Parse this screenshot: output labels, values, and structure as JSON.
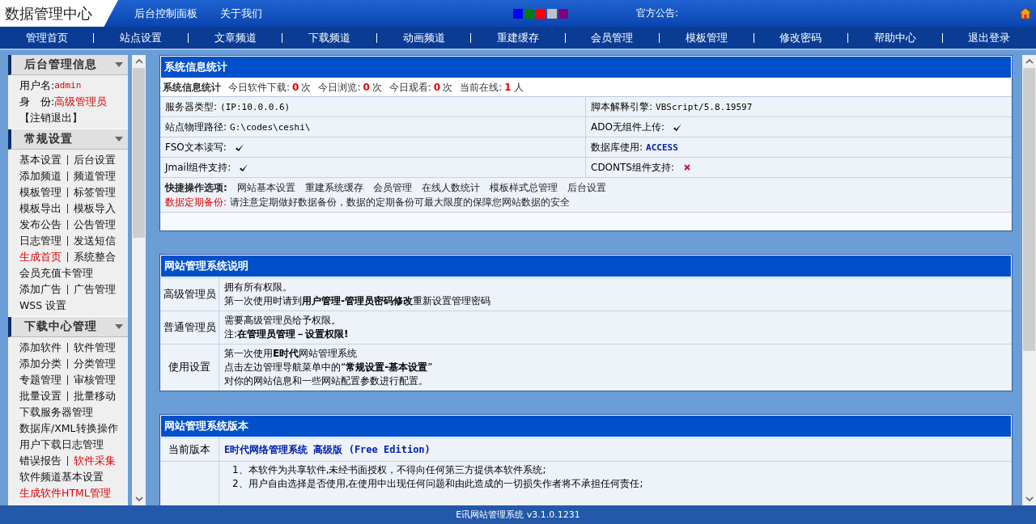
{
  "header": {
    "logo": "数据管理中心",
    "links": [
      "后台控制面板",
      "关于我们"
    ],
    "themes": [
      {
        "color": "#0000ff",
        "selected": false
      },
      {
        "color": "#008000",
        "selected": false
      },
      {
        "color": "#ff0000",
        "selected": false
      },
      {
        "color": "#c0c0c0",
        "selected": false
      },
      {
        "color": "#800080",
        "selected": false
      }
    ],
    "notice_label": "官方公告:"
  },
  "nav": [
    "管理首页",
    "站点设置",
    "文章频道",
    "下载频道",
    "动画频道",
    "重建缓存",
    "会员管理",
    "模板管理",
    "修改密码",
    "帮助中心",
    "退出登录"
  ],
  "sidebar": {
    "groups": [
      {
        "title": "后台管理信息",
        "expanded": true,
        "kind": "user",
        "username_label": "用户名:",
        "username": "admin",
        "role_label": "身　份:",
        "role": "高级管理员",
        "logout": "【注销退出】"
      },
      {
        "title": "常规设置",
        "expanded": true,
        "kind": "links",
        "lines": [
          [
            {
              "label": "基本设置",
              "emphasis": false
            },
            {
              "label": "后台设置",
              "emphasis": false
            }
          ],
          [
            {
              "label": "添加频道",
              "emphasis": false
            },
            {
              "label": "频道管理",
              "emphasis": false
            }
          ],
          [
            {
              "label": "模板管理",
              "emphasis": false
            },
            {
              "label": "标签管理",
              "emphasis": false
            }
          ],
          [
            {
              "label": "模板导出",
              "emphasis": false
            },
            {
              "label": "模板导入",
              "emphasis": false
            }
          ],
          [
            {
              "label": "发布公告",
              "emphasis": false
            },
            {
              "label": "公告管理",
              "emphasis": false
            }
          ],
          [
            {
              "label": "日志管理",
              "emphasis": false
            },
            {
              "label": "发送短信",
              "emphasis": false
            }
          ],
          [
            {
              "label": "生成首页",
              "emphasis": true
            },
            {
              "label": "系统整合",
              "emphasis": false
            }
          ],
          [
            {
              "label": "会员充值卡管理",
              "emphasis": false
            }
          ],
          [
            {
              "label": "添加广告",
              "emphasis": false
            },
            {
              "label": "广告管理",
              "emphasis": false
            }
          ],
          [
            {
              "label": "WSS 设置",
              "emphasis": false
            }
          ]
        ]
      },
      {
        "title": "下载中心管理",
        "expanded": true,
        "kind": "links",
        "lines": [
          [
            {
              "label": "添加软件",
              "emphasis": false
            },
            {
              "label": "软件管理",
              "emphasis": false
            }
          ],
          [
            {
              "label": "添加分类",
              "emphasis": false
            },
            {
              "label": "分类管理",
              "emphasis": false
            }
          ],
          [
            {
              "label": "专题管理",
              "emphasis": false
            },
            {
              "label": "审核管理",
              "emphasis": false
            }
          ],
          [
            {
              "label": "批量设置",
              "emphasis": false
            },
            {
              "label": "批量移动",
              "emphasis": false
            }
          ],
          [
            {
              "label": "下载服务器管理",
              "emphasis": false
            }
          ],
          [
            {
              "label": "数据库/XML转换操作",
              "emphasis": false
            }
          ],
          [
            {
              "label": "用户下载日志管理",
              "emphasis": false
            }
          ],
          [
            {
              "label": "错误报告",
              "emphasis": false
            },
            {
              "label": "软件采集",
              "emphasis": true
            }
          ],
          [
            {
              "label": "软件频道基本设置",
              "emphasis": false
            }
          ],
          [
            {
              "label": "生成软件HTML管理",
              "emphasis": true
            }
          ]
        ]
      }
    ]
  },
  "stats_panel": {
    "title": "系统信息统计",
    "summary_label": "系统信息统计",
    "counters": [
      {
        "label": "今日软件下载:",
        "value": "0",
        "unit": "次"
      },
      {
        "label": "今日浏览:",
        "value": "0",
        "unit": "次"
      },
      {
        "label": "今日观看:",
        "value": "0",
        "unit": "次"
      },
      {
        "label": "当前在线:",
        "value": "1",
        "unit": "人"
      }
    ],
    "rows": [
      [
        {
          "kind": "text",
          "label": "服务器类型:",
          "value": "(IP:10.0.0.6)"
        },
        {
          "kind": "text",
          "label": "脚本解释引擎:",
          "value": "VBScript/5.8.19597"
        }
      ],
      [
        {
          "kind": "text",
          "label": "站点物理路径:",
          "value": "G:\\codes\\ceshi\\"
        },
        {
          "kind": "support",
          "label": "ADO无组件上传:",
          "supported": true
        }
      ],
      [
        {
          "kind": "support",
          "label": "FSO文本读写:",
          "supported": true
        },
        {
          "kind": "db",
          "label": "数据库使用:",
          "value": "ACCESS"
        }
      ],
      [
        {
          "kind": "support",
          "label": "Jmail组件支持:",
          "supported": true
        },
        {
          "kind": "support",
          "label": "CDONTS组件支持:",
          "supported": false
        }
      ]
    ],
    "quick_label": "快捷操作选项:",
    "quick_links": [
      "网站基本设置",
      "重建系统缓存",
      "会员管理",
      "在线人数统计",
      "模板样式总管理",
      "后台设置"
    ],
    "backup_label": "数据定期备份:",
    "backup_text": "请注意定期做好数据备份，数据的定期备份可最大限度的保障您网站数据的安全"
  },
  "help_panel": {
    "title": "网站管理系统说明",
    "rows": [
      {
        "label": "高级管理员",
        "lines": [
          "拥有所有权限。",
          "第一次使用时请到**用户管理-管理员密码修改**重新设置管理密码"
        ]
      },
      {
        "label": "普通管理员",
        "lines": [
          "需要高级管理员给予权限。",
          "注:**在管理员管理－设置权限!**"
        ]
      },
      {
        "label": "使用设置",
        "lines": [
          "第一次使用**E时代**网站管理系统",
          "点击左边管理导航菜单中的“**常规设置-基本设置**”",
          "对你的网站信息和一些网站配置参数进行配置。"
        ]
      }
    ]
  },
  "version_panel": {
    "title": "网站管理系统版本",
    "version_label": "当前版本",
    "version": "E时代网络管理系统 高级版 (Free Edition)",
    "notes": [
      "1、本软件为共享软件,未经书面授权，不得向任何第三方提供本软件系统;",
      "2、用户自由选择是否使用,在使用中出现任何问题和由此造成的一切损失作者将不承担任何责任;"
    ]
  },
  "footer": "E讯网站管理系统 v3.1.0.1231"
}
